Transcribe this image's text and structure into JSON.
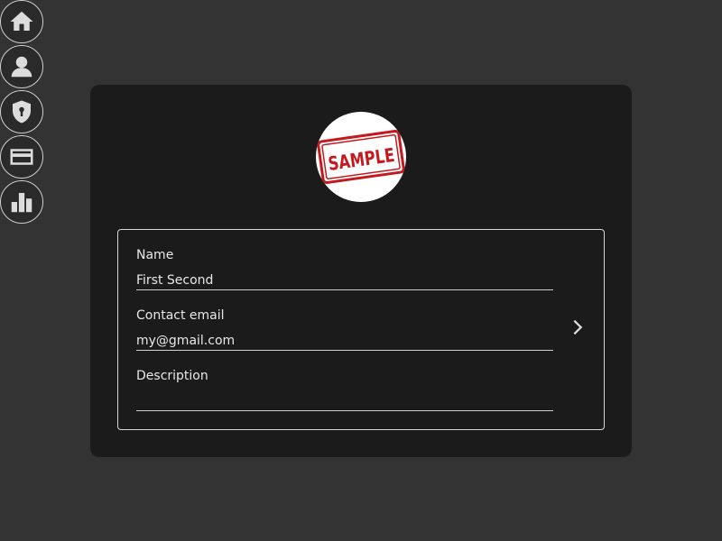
{
  "sidebar": {
    "items": [
      {
        "icon": "home-icon"
      },
      {
        "icon": "user-icon"
      },
      {
        "icon": "shield-icon"
      },
      {
        "icon": "credit-card-icon"
      },
      {
        "icon": "bar-chart-icon"
      }
    ]
  },
  "profile": {
    "avatar_text": "SAMPLE",
    "fields": {
      "name": {
        "label": "Name",
        "value": "First Second"
      },
      "email": {
        "label": "Contact email",
        "value": "my@gmail.com"
      },
      "description": {
        "label": "Description",
        "value": ""
      }
    },
    "action_icon": "chevron-right-icon"
  },
  "colors": {
    "page_bg": "#333333",
    "card_bg": "#1b1b1b",
    "text": "#e8e8e8",
    "stamp_red": "#c41a1f"
  }
}
